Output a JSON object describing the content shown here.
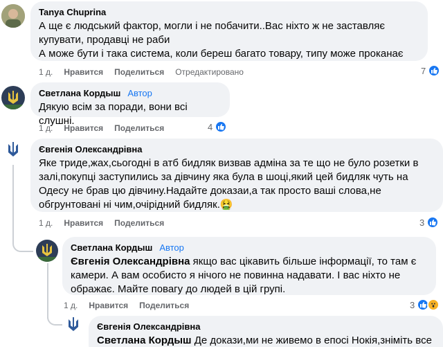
{
  "actions": {
    "like": "Нравится",
    "reply": "Поделиться"
  },
  "comments": [
    {
      "author": "Tanya Chuprina",
      "text": "А ще є людський фактор, могли і не побачити..Вас ніхто ж не заставляє купувати, продавці не раби\nА може бути і така система, коли береш багато товару, типу може проканає",
      "time": "1 д.",
      "edited": "Отредактировано",
      "reaction_count": "7"
    },
    {
      "author": "Светлана Кордыш",
      "badge": "Автор",
      "text": "Дякую всім за поради, вони всі слушні.",
      "time": "1 д.",
      "reaction_count": "4"
    },
    {
      "author": "Євгенія Олександрівна",
      "text": "Яке триде,жах,сьогодні в атб бидляк визвав адміна за те що не було розетки в залі,покупці заступились за дівчину яка була в шоці,який цей бидляк чуть на Одесу не брав цю дівчину.Надайте доказаи,а так просто ваші слова,не обгрунтовані ні чим,очірідний бидляк.🤮",
      "time": "1 д.",
      "reaction_count": "3"
    },
    {
      "author": "Светлана Кордыш",
      "badge": "Автор",
      "mention": "Євгенія Олександрівна",
      "text": " якщо вас цікавить більше інформації, то там є камери. А вам особисто я нічого не повинна надавати. І вас ніхто не ображає. Майте повагу до людей в цій групі.",
      "time": "1 д.",
      "reaction_count": "3"
    },
    {
      "author": "Євгенія Олександрівна",
      "mention": "Светлана Кордыш",
      "text": " Де докази,ми не живемо в епосі Нокія,зніміть все на"
    }
  ],
  "colors": {
    "link_blue": "#1877f2",
    "bubble": "#f0f2f5",
    "meta_gray": "#65676b"
  }
}
